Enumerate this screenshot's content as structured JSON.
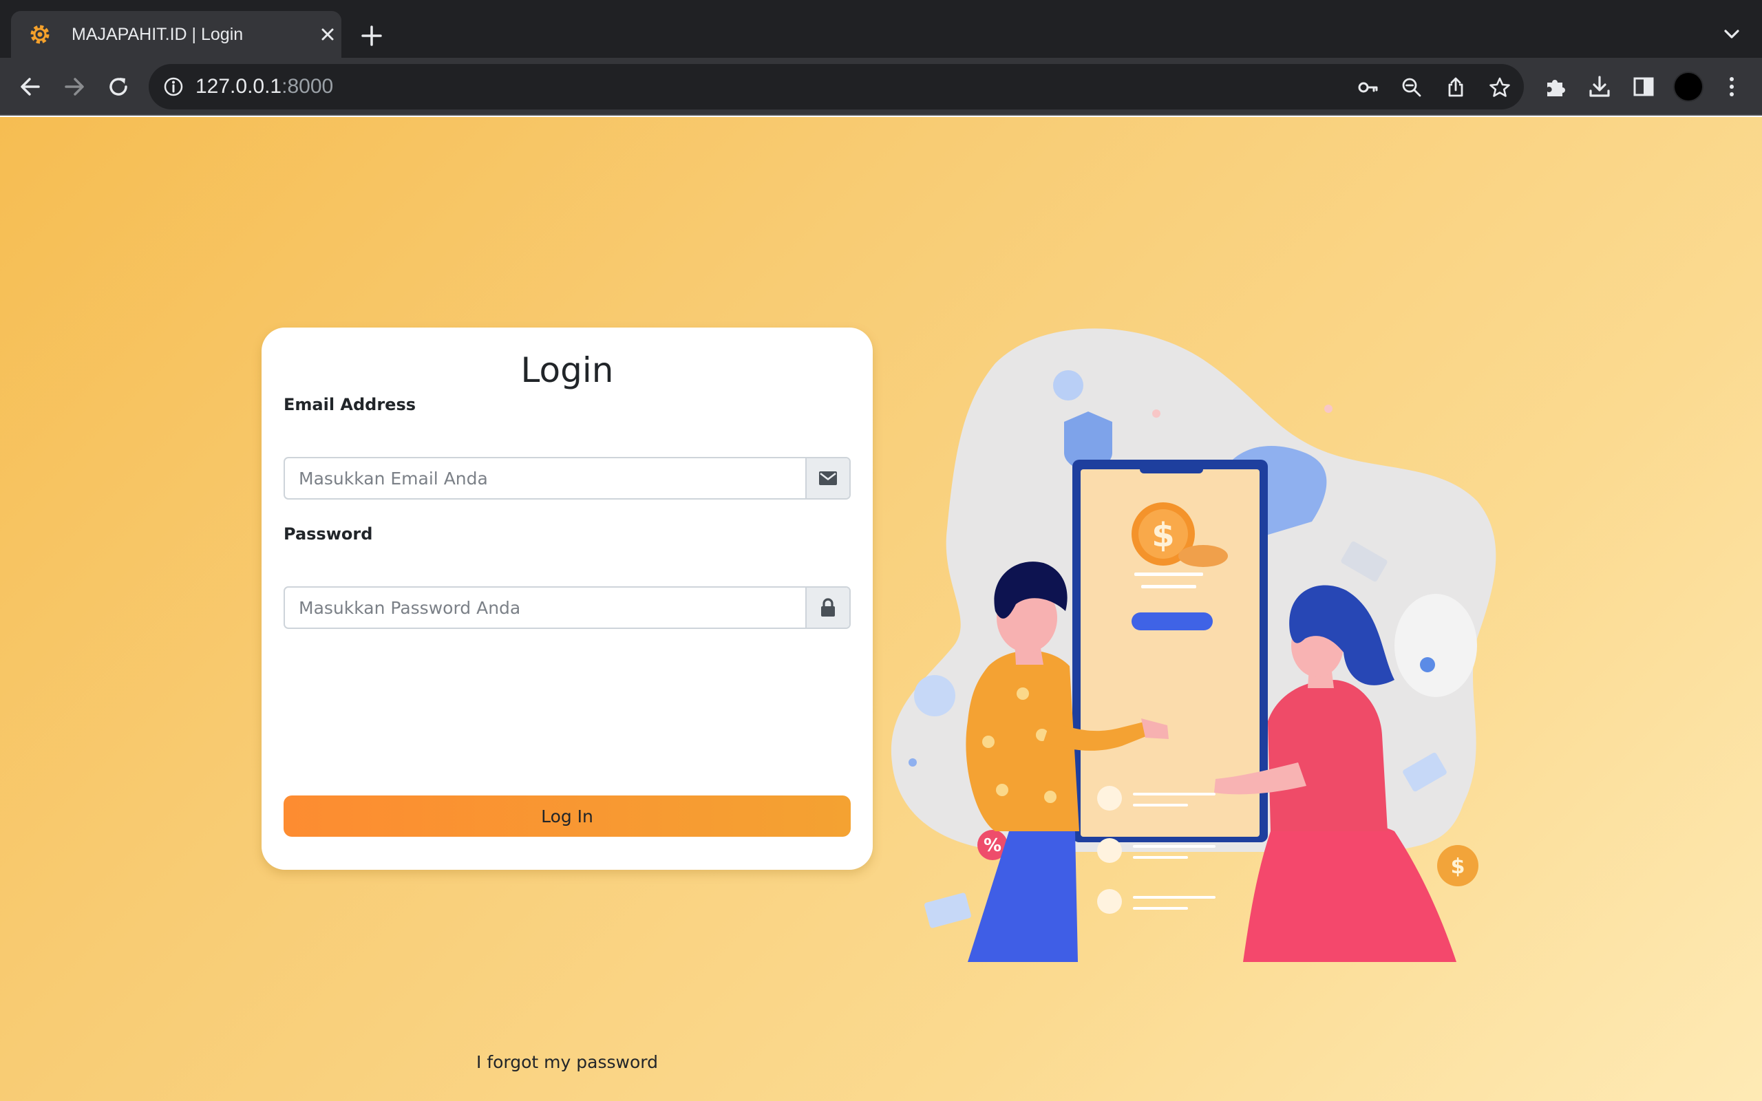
{
  "browser": {
    "tab_title": "MAJAPAHIT.ID | Login",
    "url_host": "127.0.0.1",
    "url_port": ":8000"
  },
  "login": {
    "title": "Login",
    "email_label": "Email Address",
    "email_placeholder": "Masukkan Email Anda",
    "password_label": "Password",
    "password_placeholder": "Masukkan Password Anda",
    "submit_label": "Log In",
    "forgot_label": "I forgot my password"
  },
  "colors": {
    "accent_start": "#fd8c31",
    "accent_end": "#f4a232",
    "page_bg": "#f8cc74"
  },
  "icons": {
    "email_addon": "envelope-icon",
    "password_addon": "lock-icon"
  }
}
